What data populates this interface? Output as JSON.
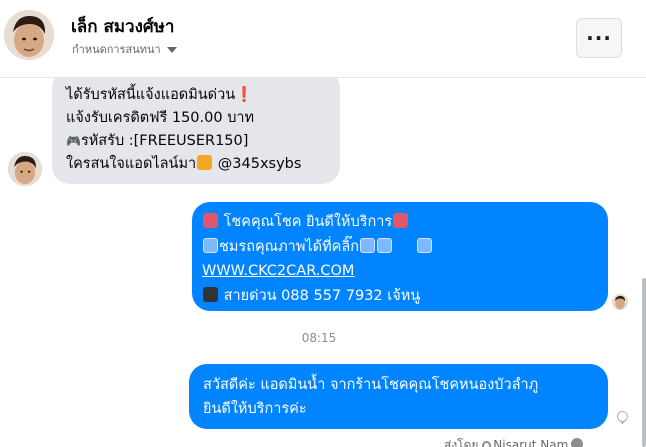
{
  "header": {
    "name": "เล็ก สมวงศ์ษา",
    "subtitle": "กำหนดการสนทนา",
    "more_label": "···"
  },
  "messages": {
    "incoming": {
      "line1": "ได้รับรหัสนี้แจ้งแอดมินด่วน",
      "line1_mark": "❗",
      "line2": "แจ้งรับเครดิตฟรี 150.00 บาท",
      "line3_icon": "🎮",
      "line3": "รหัสรับ :[FREEUSER150]",
      "line4": "ใครสนใจแอดไลน์มา",
      "line4_tail": "@345xsybs"
    },
    "outgoing_1": {
      "line1": "โชคคุณโชค ยินดีให้บริการ",
      "line2": "ชมรถคุณภาพได้ที่คลิ๊ก",
      "link": "WWW.CKC2CAR.COM",
      "line4": "สายด่วน 088 557 7932 เจ้หนู"
    },
    "timestamp": "08:15",
    "outgoing_2": {
      "line1": "สวัสดีค่ะ แอดมินน้ำ จากร้านโชคคุณโชคหนองบัวลำภู",
      "line2": "ยินดีให้บริการค่ะ"
    },
    "sent_by": {
      "prefix": "ส่งโดย",
      "name": "Nisarut Nam"
    }
  },
  "icons": {
    "more": "more-dots-icon",
    "caret": "caret-down-icon",
    "check": "seen-check-icon",
    "help": "help-icon"
  },
  "colors": {
    "outgoing_bubble": "#0084ff",
    "incoming_bubble": "#e4e6eb"
  }
}
